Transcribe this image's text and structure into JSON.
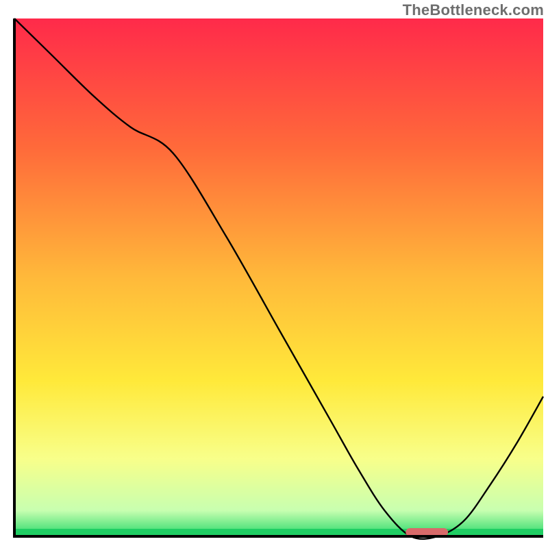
{
  "watermark": "TheBottleneck.com",
  "chart_data": {
    "type": "line",
    "title": "",
    "xlabel": "",
    "ylabel": "",
    "xlim": [
      0,
      100
    ],
    "ylim": [
      0,
      100
    ],
    "grid": false,
    "legend": false,
    "series": [
      {
        "name": "bottleneck-curve",
        "x": [
          0,
          7,
          15,
          22,
          30,
          40,
          50,
          55,
          60,
          65,
          70,
          75,
          80,
          85,
          90,
          95,
          100
        ],
        "y": [
          100,
          93,
          85,
          79,
          74,
          58,
          40,
          31,
          22,
          13,
          5,
          0,
          0,
          3,
          10,
          18,
          27
        ]
      }
    ],
    "marker": {
      "name": "optimal-range",
      "x_range": [
        74,
        82
      ],
      "y": 0,
      "color": "#d86a6a"
    },
    "background_gradient": {
      "stops": [
        {
          "offset": 0,
          "color": "#ff2a4a"
        },
        {
          "offset": 25,
          "color": "#ff6a3a"
        },
        {
          "offset": 50,
          "color": "#ffb93a"
        },
        {
          "offset": 70,
          "color": "#ffe93a"
        },
        {
          "offset": 85,
          "color": "#f8ff8a"
        },
        {
          "offset": 95,
          "color": "#c8ffb0"
        },
        {
          "offset": 100,
          "color": "#28d86a"
        }
      ]
    },
    "axis_color": "#000000",
    "curve_color": "#000000"
  }
}
